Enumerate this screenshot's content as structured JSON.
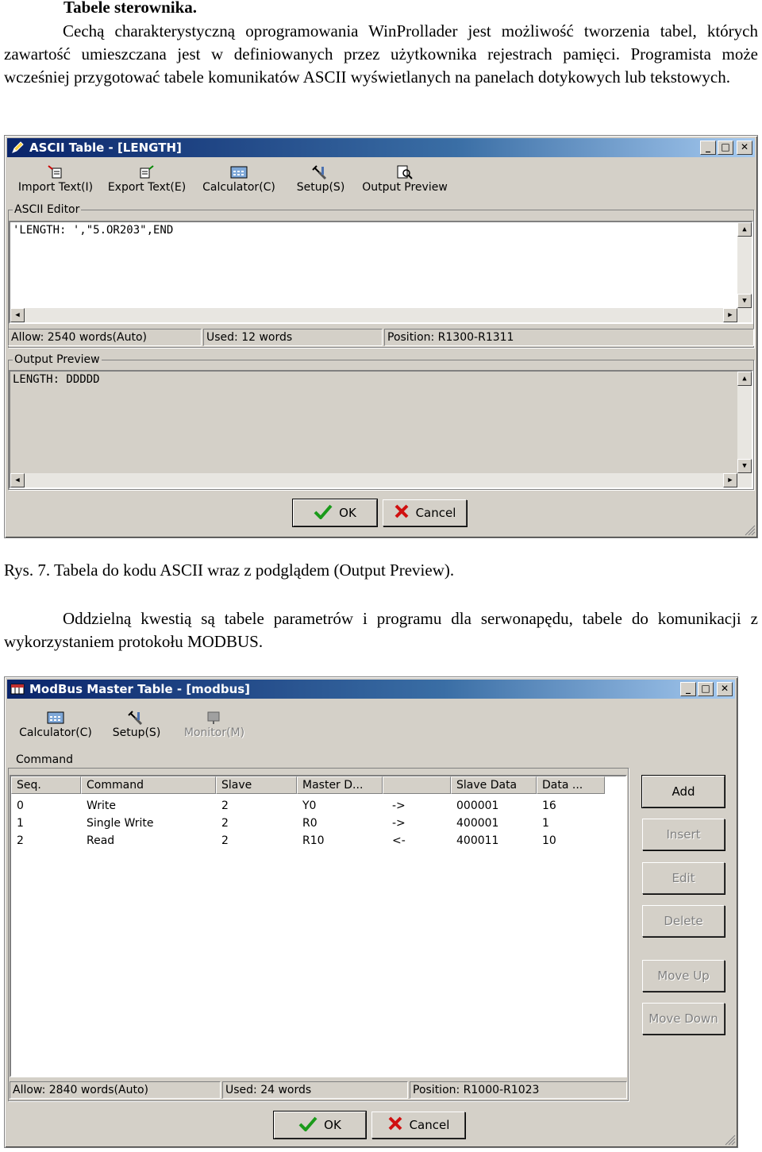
{
  "doc": {
    "heading": "Tabele sterownika.",
    "para1": "Cechą charakterystyczną oprogramowania WinProllader jest możliwość tworzenia tabel, których zawartość umieszczana jest w definiowanych przez użytkownika rejestrach pamięci. Programista może wcześniej przygotować tabele komunikatów ASCII wyświetlanych na panelach dotykowych lub tekstowych.",
    "caption1": "Rys. 7. Tabela do kodu ASCII wraz z podglądem (Output Preview).",
    "para2": "Oddzielną kwestią są tabele parametrów i programu dla serwonapędu, tabele do komunikacji z wykorzystaniem protokołu MODBUS."
  },
  "ascii_window": {
    "title": "ASCII Table - [LENGTH]",
    "toolbar": [
      "Import Text(I)",
      "Export Text(E)",
      "Calculator(C)",
      "Setup(S)",
      "Output Preview"
    ],
    "editor_label": "ASCII Editor",
    "editor_text": "'LENGTH: ',\"5.OR203\",END",
    "status_allow": "Allow: 2540 words(Auto)",
    "status_used": "Used: 12 words",
    "status_position": "Position: R1300-R1311",
    "preview_label": "Output Preview",
    "preview_text": "LENGTH: DDDDD",
    "ok_label": "OK",
    "cancel_label": "Cancel"
  },
  "modbus_window": {
    "title": "ModBus Master Table - [modbus]",
    "toolbar": [
      "Calculator(C)",
      "Setup(S)",
      "Monitor(M)"
    ],
    "command_label": "Command",
    "columns": [
      "Seq.",
      "Command",
      "Slave",
      "Master D...",
      "",
      "Slave Data",
      "Data ..."
    ],
    "rows": [
      [
        "0",
        "Write",
        "2",
        "Y0",
        "->",
        "000001",
        "16"
      ],
      [
        "1",
        "Single Write",
        "2",
        "R0",
        "->",
        "400001",
        "1"
      ],
      [
        "2",
        "Read",
        "2",
        "R10",
        "<-",
        "400011",
        "10"
      ]
    ],
    "buttons": [
      "Add",
      "Insert",
      "Edit",
      "Delete",
      "Move Up",
      "Move Down"
    ],
    "status_allow": "Allow: 2840 words(Auto)",
    "status_used": "Used: 24 words",
    "status_position": "Position: R1000-R1023",
    "ok_label": "OK",
    "cancel_label": "Cancel"
  }
}
